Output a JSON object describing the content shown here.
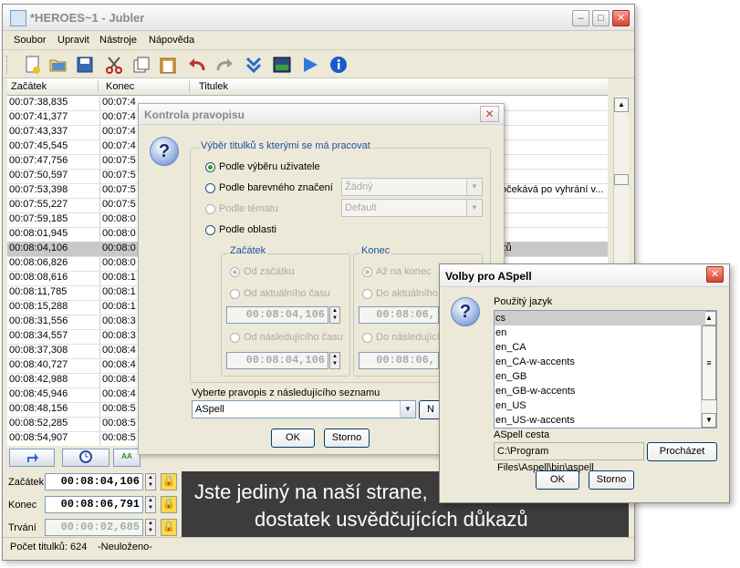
{
  "main": {
    "title": "*HEROES~1 - Jubler",
    "menu": [
      "Soubor",
      "Upravit",
      "Nástroje",
      "Nápověda"
    ],
    "columns": [
      "Začátek",
      "Konec",
      "Titulek"
    ],
    "rows": [
      {
        "start": "00:07:38,835",
        "end": "00:07:4",
        "text": ""
      },
      {
        "start": "00:07:41,377",
        "end": "00:07:4",
        "text": ""
      },
      {
        "start": "00:07:43,337",
        "end": "00:07:4",
        "text": ""
      },
      {
        "start": "00:07:45,545",
        "end": "00:07:4",
        "text": ""
      },
      {
        "start": "00:07:47,756",
        "end": "00:07:5",
        "text": ""
      },
      {
        "start": "00:07:50,597",
        "end": "00:07:5",
        "text": ""
      },
      {
        "start": "00:07:53,398",
        "end": "00:07:5",
        "text": "očekává po vyhrání v..."
      },
      {
        "start": "00:07:55,227",
        "end": "00:07:5",
        "text": ""
      },
      {
        "start": "00:07:59,185",
        "end": "00:08:0",
        "text": ""
      },
      {
        "start": "00:08:01,945",
        "end": "00:08:0",
        "text": ""
      },
      {
        "start": "00:08:04,106",
        "end": "00:08:0",
        "text": "zů"
      },
      {
        "start": "00:08:06,826",
        "end": "00:08:0",
        "text": ""
      },
      {
        "start": "00:08:08,616",
        "end": "00:08:1",
        "text": ""
      },
      {
        "start": "00:08:11,785",
        "end": "00:08:1",
        "text": ""
      },
      {
        "start": "00:08:15,288",
        "end": "00:08:1",
        "text": ""
      },
      {
        "start": "00:08:31,556",
        "end": "00:08:3",
        "text": ""
      },
      {
        "start": "00:08:34,557",
        "end": "00:08:3",
        "text": ""
      },
      {
        "start": "00:08:37,308",
        "end": "00:08:4",
        "text": ""
      },
      {
        "start": "00:08:40,727",
        "end": "00:08:4",
        "text": ""
      },
      {
        "start": "00:08:42,988",
        "end": "00:08:4",
        "text": ""
      },
      {
        "start": "00:08:45,946",
        "end": "00:08:4",
        "text": ""
      },
      {
        "start": "00:08:48,156",
        "end": "00:08:5",
        "text": ""
      },
      {
        "start": "00:08:52,285",
        "end": "00:08:5",
        "text": ""
      },
      {
        "start": "00:08:54,907",
        "end": "00:08:5",
        "text": ""
      }
    ],
    "selected_row": 10,
    "editor": {
      "start_label": "Začátek",
      "end_label": "Konec",
      "duration_label": "Trvání",
      "start_value": "00:08:04,106",
      "end_value": "00:08:06,791",
      "duration_value": "00:00:02,685"
    },
    "preview": {
      "line1": "Jste jediný na naší strane,",
      "line2": "dostatek usvědčujících důkazů"
    },
    "status": {
      "count": "Počet titulků: 624",
      "saved": "-Neuloženo-"
    }
  },
  "spellcheck_dialog": {
    "title": "Kontrola pravopisu",
    "group_title": "Výběr titulků s kterými se má pracovat",
    "options": {
      "by_selection": "Podle výběru uživatele",
      "by_color": "Podle barevného značení",
      "by_theme": "Podle tématu",
      "by_area": "Podle oblasti"
    },
    "color_combo": "Žádný",
    "theme_combo": "Default",
    "start_group": "Začátek",
    "end_group": "Konec",
    "start_options": [
      "Od začátku",
      "Od aktuálního času",
      "Od následujícího času"
    ],
    "end_options": [
      "Až na konec",
      "Do aktuálního",
      "Do následujícího"
    ],
    "start_time": "00:08:04,106",
    "start_time2": "00:08:04,106",
    "end_time": "00:08:06,",
    "end_time2": "00:08:06,",
    "choose_label": "Vyberte pravopis z následujícího seznamu",
    "engine": "ASpell",
    "settings_button": "N",
    "ok": "OK",
    "cancel": "Storno"
  },
  "aspell_dialog": {
    "title": "Volby pro ASpell",
    "language_label": "Použitý jazyk",
    "languages": [
      "cs",
      "en",
      "en_CA",
      "en_CA-w-accents",
      "en_GB",
      "en_GB-w-accents",
      "en_US",
      "en_US-w-accents"
    ],
    "selected_language": 0,
    "path_label": "ASpell cesta",
    "path_value": "C:\\Program Files\\Aspell\\bin\\aspell",
    "browse": "Procházet",
    "ok": "OK",
    "cancel": "Storno"
  }
}
